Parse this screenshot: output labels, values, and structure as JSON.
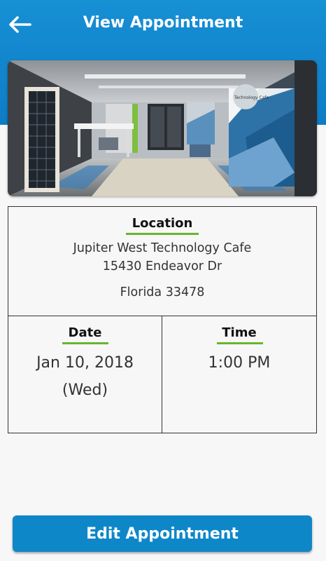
{
  "header": {
    "title": "View Appointment",
    "back_icon": "arrow-left-icon",
    "color": "#1590d5"
  },
  "photo": {
    "wall_sign_text": "Technology Cafe"
  },
  "location": {
    "label": "Location",
    "name": "Jupiter West Technology Cafe",
    "street": "15430 Endeavor Dr",
    "state_zip": "Florida 33478"
  },
  "date": {
    "label": "Date",
    "value": "Jan 10, 2018",
    "day": "(Wed)"
  },
  "time": {
    "label": "Time",
    "value": "1:00 PM"
  },
  "actions": {
    "edit_label": "Edit Appointment"
  },
  "colors": {
    "accent_underline": "#6ab42d",
    "button": "#0e87c9"
  }
}
